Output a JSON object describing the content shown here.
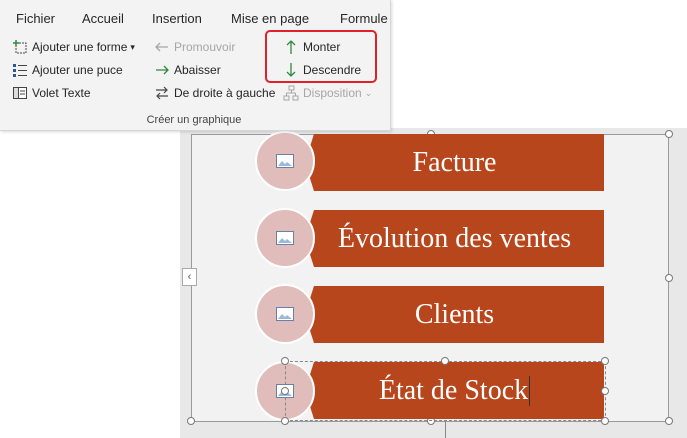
{
  "ribbon": {
    "tabs": [
      "Fichier",
      "Accueil",
      "Insertion",
      "Mise en page",
      "Formule"
    ],
    "commands": {
      "add_shape": "Ajouter une forme",
      "add_bullet": "Ajouter une puce",
      "text_pane": "Volet Texte",
      "promote": "Promouvoir",
      "demote": "Abaisser",
      "right_to_left": "De droite à gauche",
      "move_up": "Monter",
      "move_down": "Descendre",
      "layout": "Disposition"
    },
    "group_label": "Créer un graphique"
  },
  "smartart": {
    "items": [
      "Facture",
      "Évolution des ventes",
      "Clients",
      "État de Stock"
    ]
  },
  "colors": {
    "bar": "#b8461c",
    "circle": "#e0bdbb",
    "highlight": "#e0202a",
    "arrow_green": "#2e8b3a"
  }
}
